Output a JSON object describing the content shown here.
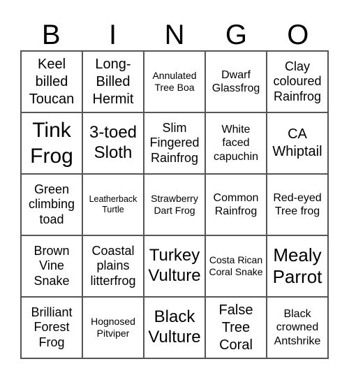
{
  "header": [
    "B",
    "I",
    "N",
    "G",
    "O"
  ],
  "cells": [
    [
      "Keel billed Toucan",
      "Long-Billed Hermit",
      "Annulated Tree Boa",
      "Dwarf Glassfrog",
      "Clay coloured Rainfrog"
    ],
    [
      "Tink Frog",
      "3-toed Sloth",
      "Slim Fingered Rainfrog",
      "White faced capuchin",
      "CA Whiptail"
    ],
    [
      "Green climbing toad",
      "Leatherback Turtle",
      "Strawberry Dart Frog",
      "Common Rainfrog",
      "Red-eyed Tree frog"
    ],
    [
      "Brown Vine Snake",
      "Coastal plains litterfrog",
      "Turkey Vulture",
      "Costa Rican Coral Snake",
      "Mealy Parrot"
    ],
    [
      "Brilliant Forest Frog",
      "Hognosed Pitviper",
      "Black Vulture",
      "False Tree Coral",
      "Black crowned Antshrike"
    ]
  ]
}
